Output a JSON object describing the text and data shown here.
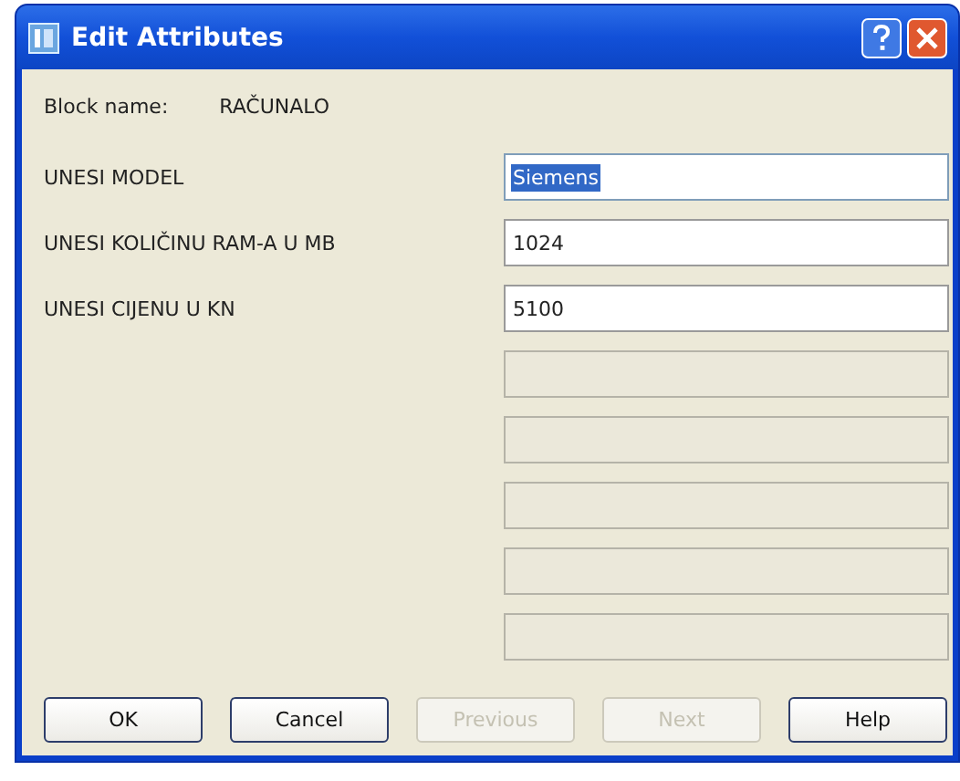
{
  "window": {
    "title": "Edit Attributes"
  },
  "block": {
    "label": "Block name:",
    "value": "RAČUNALO"
  },
  "attributes": [
    {
      "label": "UNESI MODEL",
      "value": "Siemens",
      "selected": true,
      "disabled": false
    },
    {
      "label": "UNESI KOLIČINU RAM-A  U MB",
      "value": "1024",
      "selected": false,
      "disabled": false
    },
    {
      "label": "UNESI CIJENU U KN",
      "value": "5100",
      "selected": false,
      "disabled": false
    },
    {
      "disabled": true
    },
    {
      "disabled": true
    },
    {
      "disabled": true
    },
    {
      "disabled": true
    },
    {
      "disabled": true
    }
  ],
  "buttons": [
    {
      "label": "OK",
      "disabled": false
    },
    {
      "label": "Cancel",
      "disabled": false
    },
    {
      "label": "Previous",
      "disabled": true
    },
    {
      "label": "Next",
      "disabled": true
    },
    {
      "label": "Help",
      "disabled": false
    }
  ]
}
